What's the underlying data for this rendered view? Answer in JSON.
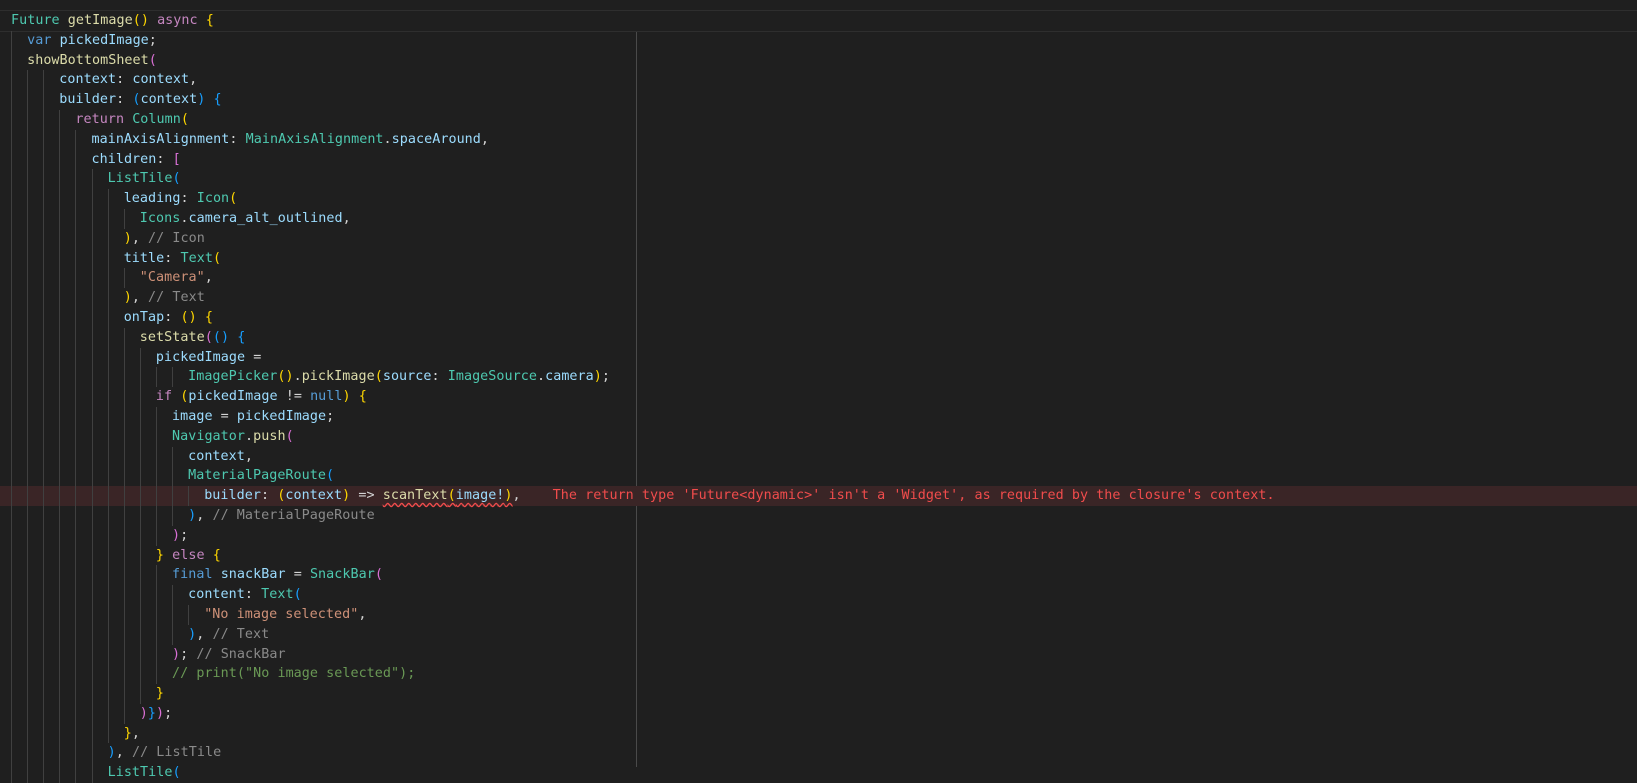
{
  "editor": {
    "language": "dart",
    "lines": [
      {
        "indent": 0,
        "tokens": [
          [
            "ty",
            "Future"
          ],
          [
            "pl",
            " "
          ],
          [
            "fn",
            "getImage"
          ],
          [
            "b1",
            "()"
          ],
          [
            "pl",
            " "
          ],
          [
            "kw2",
            "async"
          ],
          [
            "pl",
            " "
          ],
          [
            "b1",
            "{"
          ]
        ]
      },
      {
        "indent": 1,
        "tokens": [
          [
            "kw",
            "var"
          ],
          [
            "pl",
            " "
          ],
          [
            "prop",
            "pickedImage"
          ],
          [
            "pl",
            ";"
          ]
        ]
      },
      {
        "indent": 1,
        "tokens": [
          [
            "fn",
            "showBottomSheet"
          ],
          [
            "b2",
            "("
          ]
        ]
      },
      {
        "indent": 3,
        "tokens": [
          [
            "prop",
            "context"
          ],
          [
            "pl",
            ": "
          ],
          [
            "prop",
            "context"
          ],
          [
            "pl",
            ","
          ]
        ]
      },
      {
        "indent": 3,
        "tokens": [
          [
            "prop",
            "builder"
          ],
          [
            "pl",
            ": "
          ],
          [
            "b3",
            "("
          ],
          [
            "prop",
            "context"
          ],
          [
            "b3",
            ")"
          ],
          [
            "pl",
            " "
          ],
          [
            "b3",
            "{"
          ]
        ]
      },
      {
        "indent": 4,
        "tokens": [
          [
            "kw2",
            "return"
          ],
          [
            "pl",
            " "
          ],
          [
            "ty",
            "Column"
          ],
          [
            "b1",
            "("
          ]
        ]
      },
      {
        "indent": 5,
        "tokens": [
          [
            "prop",
            "mainAxisAlignment"
          ],
          [
            "pl",
            ": "
          ],
          [
            "ty",
            "MainAxisAlignment"
          ],
          [
            "pl",
            "."
          ],
          [
            "prop",
            "spaceAround"
          ],
          [
            "pl",
            ","
          ]
        ]
      },
      {
        "indent": 5,
        "tokens": [
          [
            "prop",
            "children"
          ],
          [
            "pl",
            ": "
          ],
          [
            "b2",
            "["
          ]
        ]
      },
      {
        "indent": 6,
        "tokens": [
          [
            "ty",
            "ListTile"
          ],
          [
            "b3",
            "("
          ]
        ]
      },
      {
        "indent": 7,
        "tokens": [
          [
            "prop",
            "leading"
          ],
          [
            "pl",
            ": "
          ],
          [
            "ty",
            "Icon"
          ],
          [
            "b1",
            "("
          ]
        ]
      },
      {
        "indent": 8,
        "tokens": [
          [
            "ty",
            "Icons"
          ],
          [
            "pl",
            "."
          ],
          [
            "prop",
            "camera_alt_outlined"
          ],
          [
            "pl",
            ","
          ]
        ]
      },
      {
        "indent": 7,
        "tokens": [
          [
            "b1",
            ")"
          ],
          [
            "pl",
            ", "
          ],
          [
            "cm",
            "// Icon"
          ]
        ]
      },
      {
        "indent": 7,
        "tokens": [
          [
            "prop",
            "title"
          ],
          [
            "pl",
            ": "
          ],
          [
            "ty",
            "Text"
          ],
          [
            "b1",
            "("
          ]
        ]
      },
      {
        "indent": 8,
        "tokens": [
          [
            "str",
            "\"Camera\""
          ],
          [
            "pl",
            ","
          ]
        ]
      },
      {
        "indent": 7,
        "tokens": [
          [
            "b1",
            ")"
          ],
          [
            "pl",
            ", "
          ],
          [
            "cm",
            "// Text"
          ]
        ]
      },
      {
        "indent": 7,
        "tokens": [
          [
            "prop",
            "onTap"
          ],
          [
            "pl",
            ": "
          ],
          [
            "b1",
            "()"
          ],
          [
            "pl",
            " "
          ],
          [
            "b1",
            "{"
          ]
        ]
      },
      {
        "indent": 8,
        "tokens": [
          [
            "fn",
            "setState"
          ],
          [
            "b2",
            "("
          ],
          [
            "b3",
            "()"
          ],
          [
            "pl",
            " "
          ],
          [
            "b3",
            "{"
          ]
        ]
      },
      {
        "indent": 9,
        "tokens": [
          [
            "prop",
            "pickedImage"
          ],
          [
            "pl",
            " ="
          ]
        ]
      },
      {
        "indent": 11,
        "tokens": [
          [
            "ty",
            "ImagePicker"
          ],
          [
            "b1",
            "()"
          ],
          [
            "pl",
            "."
          ],
          [
            "fn",
            "pickImage"
          ],
          [
            "b1",
            "("
          ],
          [
            "prop",
            "source"
          ],
          [
            "pl",
            ": "
          ],
          [
            "ty",
            "ImageSource"
          ],
          [
            "pl",
            "."
          ],
          [
            "prop",
            "camera"
          ],
          [
            "b1",
            ")"
          ],
          [
            "pl",
            ";"
          ]
        ]
      },
      {
        "indent": 9,
        "tokens": [
          [
            "kw2",
            "if"
          ],
          [
            "pl",
            " "
          ],
          [
            "b1",
            "("
          ],
          [
            "prop",
            "pickedImage"
          ],
          [
            "pl",
            " != "
          ],
          [
            "kw",
            "null"
          ],
          [
            "b1",
            ")"
          ],
          [
            "pl",
            " "
          ],
          [
            "b1",
            "{"
          ]
        ]
      },
      {
        "indent": 10,
        "tokens": [
          [
            "prop",
            "image"
          ],
          [
            "pl",
            " = "
          ],
          [
            "prop",
            "pickedImage"
          ],
          [
            "pl",
            ";"
          ]
        ]
      },
      {
        "indent": 10,
        "tokens": [
          [
            "ty",
            "Navigator"
          ],
          [
            "pl",
            "."
          ],
          [
            "fn",
            "push"
          ],
          [
            "b2",
            "("
          ]
        ]
      },
      {
        "indent": 11,
        "tokens": [
          [
            "prop",
            "context"
          ],
          [
            "pl",
            ","
          ]
        ]
      },
      {
        "indent": 11,
        "tokens": [
          [
            "ty",
            "MaterialPageRoute"
          ],
          [
            "b3",
            "("
          ]
        ]
      },
      {
        "indent": 12,
        "error": true,
        "tokens": [
          [
            "prop",
            "builder"
          ],
          [
            "pl",
            ": "
          ],
          [
            "b1",
            "("
          ],
          [
            "prop",
            "context"
          ],
          [
            "b1",
            ")"
          ],
          [
            "pl",
            " => "
          ],
          [
            "fnerr",
            "scanText"
          ],
          [
            "b1err",
            "("
          ],
          [
            "properr",
            "image!"
          ],
          [
            "b1err",
            ")"
          ],
          [
            "pl",
            ","
          ]
        ],
        "diagnostic": "The return type 'Future<dynamic>' isn't a 'Widget', as required by the closure's context."
      },
      {
        "indent": 11,
        "tokens": [
          [
            "b3",
            ")"
          ],
          [
            "pl",
            ", "
          ],
          [
            "cm",
            "// MaterialPageRoute"
          ]
        ]
      },
      {
        "indent": 10,
        "tokens": [
          [
            "b2",
            ")"
          ],
          [
            "pl",
            ";"
          ]
        ]
      },
      {
        "indent": 9,
        "tokens": [
          [
            "b1",
            "}"
          ],
          [
            "pl",
            " "
          ],
          [
            "kw2",
            "else"
          ],
          [
            "pl",
            " "
          ],
          [
            "b1",
            "{"
          ]
        ]
      },
      {
        "indent": 10,
        "tokens": [
          [
            "kw",
            "final"
          ],
          [
            "pl",
            " "
          ],
          [
            "prop",
            "snackBar"
          ],
          [
            "pl",
            " = "
          ],
          [
            "ty",
            "SnackBar"
          ],
          [
            "b2",
            "("
          ]
        ]
      },
      {
        "indent": 11,
        "tokens": [
          [
            "prop",
            "content"
          ],
          [
            "pl",
            ": "
          ],
          [
            "ty",
            "Text"
          ],
          [
            "b3",
            "("
          ]
        ]
      },
      {
        "indent": 12,
        "tokens": [
          [
            "str",
            "\"No image selected\""
          ],
          [
            "pl",
            ","
          ]
        ]
      },
      {
        "indent": 11,
        "tokens": [
          [
            "b3",
            ")"
          ],
          [
            "pl",
            ", "
          ],
          [
            "cm",
            "// Text"
          ]
        ]
      },
      {
        "indent": 10,
        "tokens": [
          [
            "b2",
            ")"
          ],
          [
            "pl",
            "; "
          ],
          [
            "cm",
            "// SnackBar"
          ]
        ]
      },
      {
        "indent": 10,
        "tokens": [
          [
            "cmg",
            "// print(\"No image selected\");"
          ]
        ]
      },
      {
        "indent": 9,
        "tokens": [
          [
            "b1",
            "}"
          ]
        ]
      },
      {
        "indent": 8,
        "tokens": [
          [
            "b2",
            ")"
          ],
          [
            "b3",
            "}"
          ],
          [
            "b2",
            ")"
          ],
          [
            "pl",
            ";"
          ]
        ]
      },
      {
        "indent": 7,
        "tokens": [
          [
            "b1",
            "}"
          ],
          [
            "pl",
            ","
          ]
        ]
      },
      {
        "indent": 6,
        "tokens": [
          [
            "b3",
            ")"
          ],
          [
            "pl",
            ", "
          ],
          [
            "cm",
            "// ListTile"
          ]
        ]
      },
      {
        "indent": 6,
        "tokens": [
          [
            "ty",
            "ListTile"
          ],
          [
            "b3",
            "("
          ]
        ]
      }
    ]
  }
}
